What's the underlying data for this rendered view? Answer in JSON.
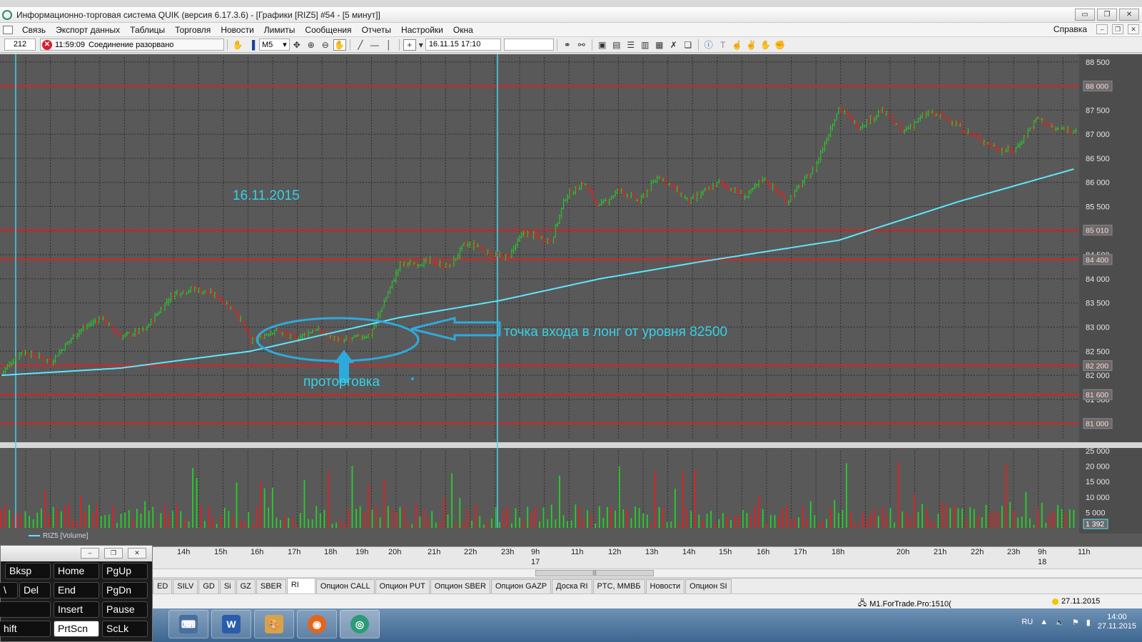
{
  "window": {
    "title": "Информационно-торговая система QUIK (версия 6.17.3.6) - [Графики [RIZ5] #54 - [5 минут]]",
    "buttons": [
      "▭",
      "❐",
      "✕"
    ]
  },
  "menu": {
    "items": [
      "Связь",
      "Экспорт данных",
      "Таблицы",
      "Торговля",
      "Новости",
      "Лимиты",
      "Сообщения",
      "Отчеты",
      "Настройки",
      "Окна"
    ],
    "help": "Справка"
  },
  "toolbar": {
    "counter": "212",
    "connection_time": "11:59:09",
    "connection_status": "Соединение разорвано",
    "interval": "M5",
    "datetime": "16.11.15 17:10"
  },
  "chart": {
    "price_axis_labels": [
      "88 500",
      "88 000",
      "87 500",
      "87 000",
      "86 500",
      "86 000",
      "85 500",
      "85 000",
      "84 500",
      "84 000",
      "83 500",
      "83 000",
      "82 500",
      "82 000",
      "81 500",
      "81 000"
    ],
    "level_labels": [
      "88 000",
      "85 010",
      "84 400",
      "82 200",
      "81 600",
      "81 000"
    ],
    "volume_axis_labels": [
      "25 000",
      "20 000",
      "15 000",
      "10 000",
      "5 000"
    ],
    "volume_current": "1 392",
    "volume_legend": "RIZ5 [Volume]",
    "annotation_date": "16.11.2015",
    "annotation_entry": "точка входа в лонг от уровня 82500",
    "annotation_range": "проторговка",
    "colors": {
      "background": "#595959",
      "grid": "#2e2e2e",
      "level_line": "#e01f1f",
      "ma_line": "#5ee6ff",
      "bull": "#25d12a",
      "bear": "#e81e1e",
      "annotation": "#34d2e6"
    }
  },
  "chart_data": {
    "type": "candlestick",
    "title": "Графики [RIZ5] #54 - [5 минут]",
    "instrument": "RIZ5",
    "timeframe": "5 минут",
    "ylim": [
      80700,
      88600
    ],
    "horizontal_levels": [
      88000,
      85010,
      84400,
      82200,
      81600,
      81000
    ],
    "series": [
      {
        "name": "RIZ5",
        "type": "price",
        "path": [
          [
            0,
            82050
          ],
          [
            10,
            82500
          ],
          [
            25,
            82300
          ],
          [
            38,
            82900
          ],
          [
            50,
            83200
          ],
          [
            60,
            82800
          ],
          [
            72,
            82950
          ],
          [
            86,
            83700
          ],
          [
            97,
            83800
          ],
          [
            108,
            83650
          ],
          [
            118,
            83300
          ],
          [
            125,
            82700
          ],
          [
            137,
            82950
          ],
          [
            147,
            82750
          ],
          [
            157,
            82950
          ],
          [
            170,
            82700
          ],
          [
            185,
            82850
          ],
          [
            200,
            84300
          ],
          [
            215,
            84350
          ],
          [
            225,
            84250
          ],
          [
            232,
            84700
          ],
          [
            238,
            84700
          ],
          [
            246,
            84500
          ],
          [
            254,
            84450
          ],
          [
            262,
            84950
          ],
          [
            276,
            84800
          ],
          [
            283,
            85700
          ],
          [
            292,
            86000
          ],
          [
            300,
            85500
          ],
          [
            310,
            85850
          ],
          [
            320,
            85600
          ],
          [
            330,
            86150
          ],
          [
            345,
            85600
          ],
          [
            360,
            86000
          ],
          [
            374,
            85700
          ],
          [
            382,
            86100
          ],
          [
            394,
            85600
          ],
          [
            408,
            86300
          ],
          [
            420,
            87550
          ],
          [
            430,
            87150
          ],
          [
            442,
            87500
          ],
          [
            452,
            87050
          ],
          [
            465,
            87450
          ],
          [
            476,
            87300
          ],
          [
            486,
            87000
          ],
          [
            500,
            86700
          ],
          [
            508,
            86650
          ],
          [
            520,
            87350
          ],
          [
            528,
            87100
          ],
          [
            540,
            87100
          ]
        ]
      },
      {
        "name": "MA",
        "type": "line",
        "path": [
          [
            0,
            82000
          ],
          [
            60,
            82150
          ],
          [
            125,
            82500
          ],
          [
            200,
            83200
          ],
          [
            250,
            83550
          ],
          [
            300,
            84000
          ],
          [
            350,
            84350
          ],
          [
            420,
            84800
          ],
          [
            480,
            85600
          ],
          [
            540,
            86300
          ]
        ]
      },
      {
        "name": "RIZ5 [Volume]",
        "type": "volume",
        "ylim": [
          0,
          25000
        ]
      }
    ],
    "x_tick_labels": [
      "14h",
      "15h",
      "16h",
      "17h",
      "18h",
      "19h",
      "20h",
      "21h",
      "22h",
      "23h",
      "9h 17",
      "11h",
      "12h",
      "13h",
      "14h",
      "15h",
      "16h",
      "17h",
      "18h",
      "20h",
      "21h",
      "22h",
      "23h",
      "9h 18",
      "11h"
    ]
  },
  "timeline": {
    "labels": [
      "14h",
      "15h",
      "16h",
      "17h",
      "18h",
      "19h",
      "20h",
      "21h",
      "22h",
      "23h",
      "9h",
      "11h",
      "12h",
      "13h",
      "14h",
      "15h",
      "16h",
      "17h",
      "18h",
      "20h",
      "21h",
      "22h",
      "23h",
      "9h",
      "11h"
    ],
    "day_markers": [
      "17",
      "18"
    ]
  },
  "tabs": [
    "ED",
    "SILV",
    "GD",
    "Si",
    "GZ",
    "SBER",
    "RI",
    "Опцион CALL",
    "Опцион PUT",
    "Опцион SBER",
    "Опцион GAZP",
    "Доска RI",
    "PTC, ММВБ",
    "Новости",
    "Опцион SI"
  ],
  "active_tab": "RI",
  "statusbar": {
    "connection": "M1.ForTrade.Pro:1510(",
    "date": "27.11.2015"
  },
  "taskbar": {
    "lang": "RU",
    "time": "14:00",
    "date": "27.11.2015"
  },
  "keyboard": {
    "keys": [
      [
        "Bksp",
        "Home",
        "PgUp"
      ],
      [
        "\\",
        "Del",
        "End",
        "PgDn"
      ],
      [
        "",
        "Insert",
        "Pause"
      ],
      [
        "hift",
        "PrtScn",
        "ScLk"
      ]
    ]
  }
}
